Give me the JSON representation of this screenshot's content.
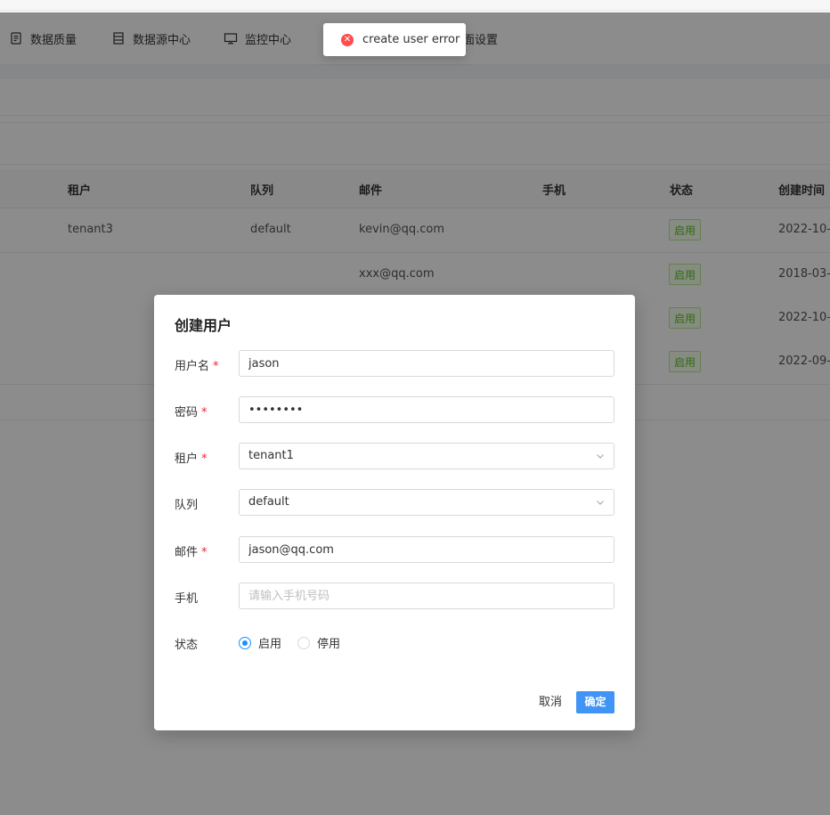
{
  "nav": {
    "items": [
      {
        "label": "数据质量",
        "icon": "quality-icon"
      },
      {
        "label": "数据源中心",
        "icon": "datasource-icon"
      },
      {
        "label": "监控中心",
        "icon": "monitor-icon"
      },
      {
        "label": "面设置",
        "icon": ""
      }
    ]
  },
  "table": {
    "headers": [
      "租户",
      "队列",
      "邮件",
      "手机",
      "状态",
      "创建时间"
    ],
    "rows": [
      {
        "tenant": "tenant3",
        "queue": "default",
        "email": "kevin@qq.com",
        "phone": "",
        "status": "启用",
        "created": "2022-10-"
      },
      {
        "tenant": "",
        "queue": "",
        "email": "xxx@qq.com",
        "phone": "",
        "status": "启用",
        "created": "2018-03-"
      },
      {
        "tenant": "",
        "queue": "",
        "email": "",
        "phone": "",
        "status": "启用",
        "created": "2022-10-"
      },
      {
        "tenant": "",
        "queue": "",
        "email": "",
        "phone": "",
        "status": "启用",
        "created": "2022-09-"
      }
    ]
  },
  "toast": {
    "message": "create user error"
  },
  "modal": {
    "title": "创建用户",
    "fields": {
      "username": {
        "label": "用户名",
        "value": "jason"
      },
      "password": {
        "label": "密码",
        "value": "jason123"
      },
      "tenant": {
        "label": "租户",
        "value": "tenant1"
      },
      "queue": {
        "label": "队列",
        "value": "default"
      },
      "email": {
        "label": "邮件",
        "value": "jason@qq.com"
      },
      "phone": {
        "label": "手机",
        "placeholder": "请输入手机号码",
        "value": ""
      },
      "status": {
        "label": "状态",
        "options": [
          "启用",
          "停用"
        ],
        "selected": "启用"
      }
    },
    "required_mark": "*",
    "cancel_label": "取消",
    "ok_label": "确定"
  },
  "colors": {
    "primary": "#1890ff",
    "ok_button": "#3f94f6",
    "success_tag": "#52c41a",
    "error": "#ff4d4f"
  }
}
